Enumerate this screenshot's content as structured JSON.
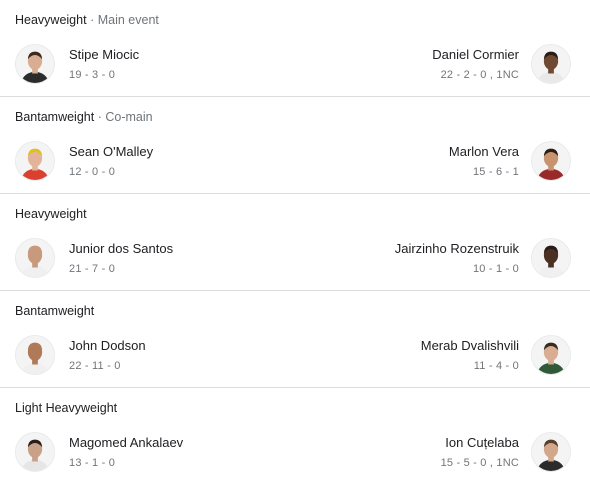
{
  "fights": [
    {
      "weight_class": "Heavyweight",
      "tag": "Main event",
      "fighter_a": {
        "name": "Stipe Miocic",
        "record": "19 - 3 - 0",
        "skin": "#d8ad92",
        "hair": "#3b2a20",
        "shirt": "#2b2b2b"
      },
      "fighter_b": {
        "name": "Daniel Cormier",
        "record": "22 - 2 - 0 , 1NC",
        "skin": "#6e4a33",
        "hair": "#2a1c14",
        "shirt": "#e9e9e9"
      }
    },
    {
      "weight_class": "Bantamweight",
      "tag": "Co-main",
      "fighter_a": {
        "name": "Sean O'Malley",
        "record": "12 - 0 - 0",
        "skin": "#e2b59a",
        "hair": "#e0c020",
        "shirt": "#d94030"
      },
      "fighter_b": {
        "name": "Marlon Vera",
        "record": "15 - 6 - 1",
        "skin": "#c8946f",
        "hair": "#2c1f17",
        "shirt": "#9a2a2a"
      }
    },
    {
      "weight_class": "Heavyweight",
      "tag": "",
      "fighter_a": {
        "name": "Junior dos Santos",
        "record": "21 - 7 - 0",
        "skin": "#c79a7e",
        "hair": "#c79a7e",
        "shirt": "#f0f0f0"
      },
      "fighter_b": {
        "name": "Jairzinho Rozenstruik",
        "record": "10 - 1 - 0",
        "skin": "#4a3124",
        "hair": "#2a1c14",
        "shirt": "#f0f0f0"
      }
    },
    {
      "weight_class": "Bantamweight",
      "tag": "",
      "fighter_a": {
        "name": "John Dodson",
        "record": "22 - 11 - 0",
        "skin": "#b07a58",
        "hair": "#b07a58",
        "shirt": "#f0f0f0"
      },
      "fighter_b": {
        "name": "Merab Dvalishvili",
        "record": "11 - 4 - 0",
        "skin": "#d8ad92",
        "hair": "#3a2a20",
        "shirt": "#2e5a3a"
      }
    },
    {
      "weight_class": "Light Heavyweight",
      "tag": "",
      "fighter_a": {
        "name": "Magomed Ankalaev",
        "record": "13 - 1 - 0",
        "skin": "#c9a088",
        "hair": "#2a1f18",
        "shirt": "#e6e6e6"
      },
      "fighter_b": {
        "name": "Ion Cuțelaba",
        "record": "15 - 5 - 0 , 1NC",
        "skin": "#d2a78b",
        "hair": "#5a3e2c",
        "shirt": "#2b2b2b"
      }
    }
  ],
  "separator": "·",
  "colors": {
    "primary_text": "#202124",
    "secondary_text": "#70757a",
    "divider": "#dadce0"
  }
}
